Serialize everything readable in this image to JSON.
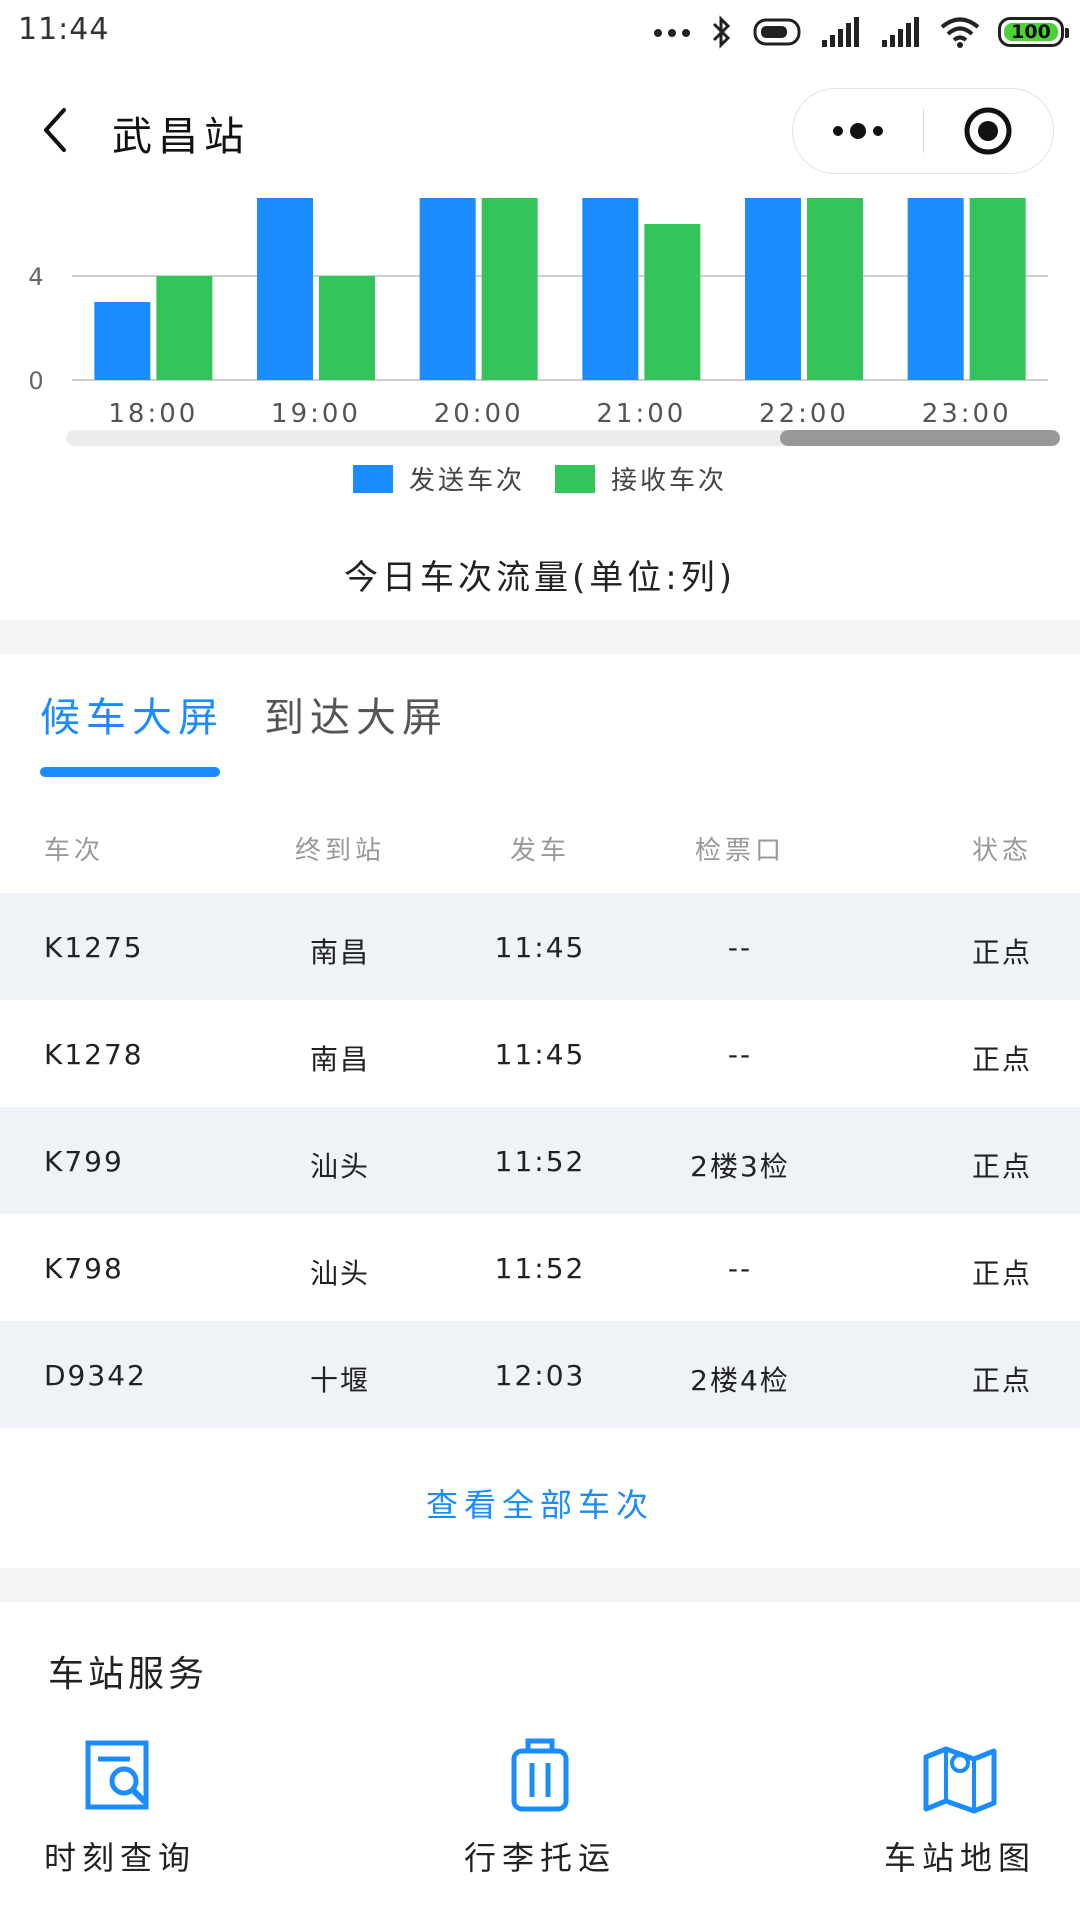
{
  "status_bar": {
    "time": "11:44",
    "battery": "100",
    "battery_color": "#4cd137"
  },
  "navbar": {
    "title": "武昌站",
    "back_icon": "chevron-left-icon",
    "menu_icon": "more-dots-icon",
    "close_icon": "target-circle-icon"
  },
  "chart_data": {
    "type": "bar",
    "categories": [
      "18:00",
      "19:00",
      "20:00",
      "21:00",
      "22:00",
      "23:00"
    ],
    "series": [
      {
        "name": "发送车次",
        "color": "#1a8cff",
        "values": [
          3,
          7,
          7,
          7,
          7,
          7
        ]
      },
      {
        "name": "接收车次",
        "color": "#33c45a",
        "values": [
          4,
          4,
          7,
          6,
          7,
          7
        ]
      }
    ],
    "y_ticks": [
      "0",
      "4"
    ],
    "ylim": [
      0,
      7
    ],
    "grid": true,
    "legend": "bottom",
    "title": "今日车次流量(单位:列)",
    "scrollbar": true
  },
  "tabs": [
    {
      "label": "候车大屏",
      "active": true
    },
    {
      "label": "到达大屏",
      "active": false
    }
  ],
  "table": {
    "headers": [
      "车次",
      "终到站",
      "发车",
      "检票口",
      "状态"
    ],
    "rows": [
      {
        "train": "K1275",
        "terminal": "南昌",
        "depart": "11:45",
        "gate": "--",
        "status": "正点"
      },
      {
        "train": "K1278",
        "terminal": "南昌",
        "depart": "11:45",
        "gate": "--",
        "status": "正点"
      },
      {
        "train": "K799",
        "terminal": "汕头",
        "depart": "11:52",
        "gate": "2楼3检",
        "status": "正点"
      },
      {
        "train": "K798",
        "terminal": "汕头",
        "depart": "11:52",
        "gate": "--",
        "status": "正点"
      },
      {
        "train": "D9342",
        "terminal": "十堰",
        "depart": "12:03",
        "gate": "2楼4检",
        "status": "正点"
      }
    ]
  },
  "view_all": "查看全部车次",
  "services": {
    "title": "车站服务",
    "items": [
      {
        "label": "时刻查询",
        "icon": "schedule-search-icon"
      },
      {
        "label": "行李托运",
        "icon": "luggage-icon"
      },
      {
        "label": "车站地图",
        "icon": "station-map-icon"
      }
    ]
  },
  "colors": {
    "accent": "#1a8cff",
    "row_alt": "#eff3f8"
  }
}
